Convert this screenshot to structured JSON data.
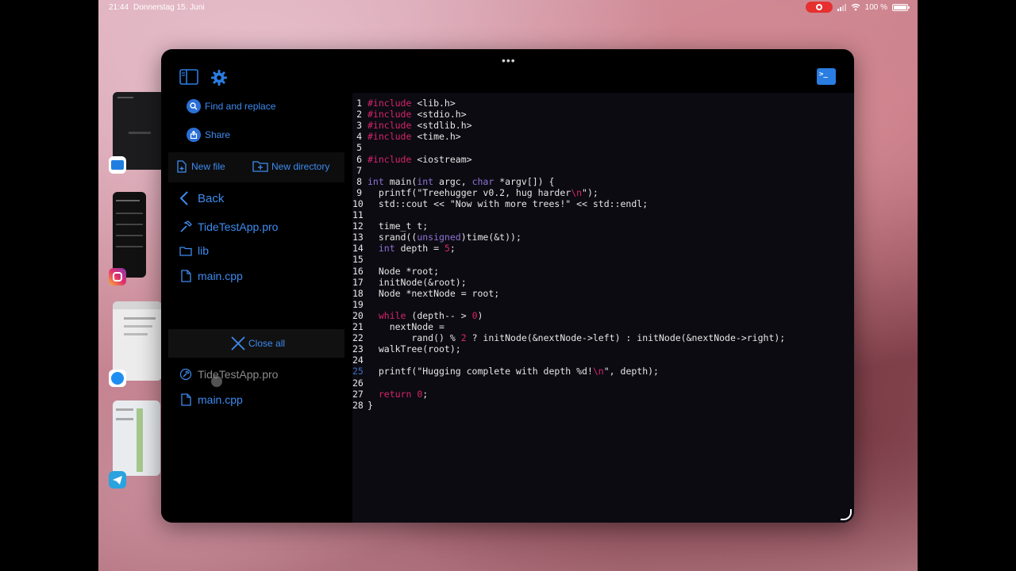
{
  "status": {
    "time": "21:44",
    "date": "Donnerstag 15. Juni",
    "battery": "100 %",
    "battery_level": 1.0
  },
  "sidebar": {
    "find_replace": "Find and replace",
    "share": "Share",
    "new_file": "New file",
    "new_directory": "New directory",
    "back": "Back",
    "browser_items": [
      {
        "label": "TideTestApp.pro",
        "icon": "hammer-icon"
      },
      {
        "label": "lib",
        "icon": "folder-icon"
      },
      {
        "label": "main.cpp",
        "icon": "document-icon"
      }
    ],
    "close_all": "Close all",
    "open_files": [
      {
        "label": "TideTestApp.pro",
        "icon": "hammer-icon"
      },
      {
        "label": "main.cpp",
        "icon": "document-icon"
      }
    ]
  },
  "editor": {
    "current_line": 25,
    "lines": [
      "#include <lib.h>",
      "#include <stdio.h>",
      "#include <stdlib.h>",
      "#include <time.h>",
      "",
      "#include <iostream>",
      "",
      "int main(int argc, char *argv[]) {",
      "  printf(\"Treehugger v0.2, hug harder\\n\");",
      "  std::cout << \"Now with more trees!\" << std::endl;",
      "",
      "  time_t t;",
      "  srand((unsigned)time(&t));",
      "  int depth = 5;",
      "",
      "  Node *root;",
      "  initNode(&root);",
      "  Node *nextNode = root;",
      "",
      "  while (depth-- > 0)",
      "    nextNode =",
      "        rand() % 2 ? initNode(&nextNode->left) : initNode(&nextNode->right);",
      "  walkTree(root);",
      "",
      "  printf(\"Hugging complete with depth %d!\\n\", depth);",
      "",
      "  return 0;",
      "}"
    ]
  },
  "colors": {
    "accent": "#2a7de1",
    "keyword": "#d6246b",
    "type": "#8f73d6",
    "editor_bg": "#0c0b12"
  }
}
